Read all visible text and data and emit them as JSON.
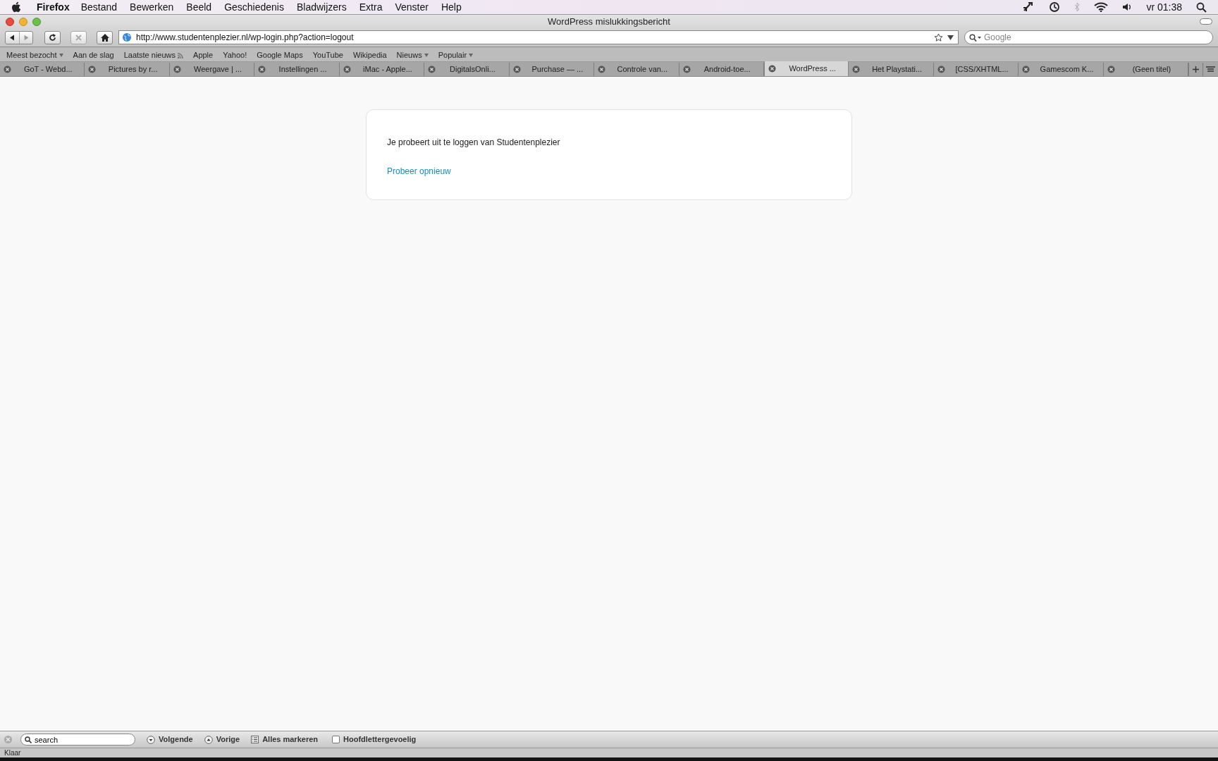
{
  "menu_bar": {
    "app": "Firefox",
    "items": [
      "Bestand",
      "Bewerken",
      "Beeld",
      "Geschiedenis",
      "Bladwijzers",
      "Extra",
      "Venster",
      "Help"
    ],
    "clock": "vr 01:38"
  },
  "window": {
    "title": "WordPress mislukkingsbericht"
  },
  "toolbar": {
    "url": "http://www.studentenplezier.nl/wp-login.php?action=logout",
    "search_placeholder": "Google"
  },
  "bookmarks": [
    {
      "label": "Meest bezocht",
      "kind": "folder"
    },
    {
      "label": "Aan de slag",
      "kind": "link"
    },
    {
      "label": "Laatste nieuws",
      "kind": "feed"
    },
    {
      "label": "Apple",
      "kind": "link"
    },
    {
      "label": "Yahoo!",
      "kind": "link"
    },
    {
      "label": "Google Maps",
      "kind": "link"
    },
    {
      "label": "YouTube",
      "kind": "link"
    },
    {
      "label": "Wikipedia",
      "kind": "link"
    },
    {
      "label": "Nieuws",
      "kind": "folder"
    },
    {
      "label": "Populair",
      "kind": "folder"
    }
  ],
  "tabs": [
    {
      "label": "GoT - Webd...",
      "selected": false
    },
    {
      "label": "Pictures by r...",
      "selected": false
    },
    {
      "label": "Weergave | ...",
      "selected": false
    },
    {
      "label": "Instellingen ...",
      "selected": false
    },
    {
      "label": "iMac - Apple...",
      "selected": false
    },
    {
      "label": "DigitalsOnli...",
      "selected": false
    },
    {
      "label": "Purchase — ...",
      "selected": false
    },
    {
      "label": "Controle van...",
      "selected": false
    },
    {
      "label": "Android-toe...",
      "selected": false
    },
    {
      "label": "WordPress ...",
      "selected": true
    },
    {
      "label": "Het Playstati...",
      "selected": false
    },
    {
      "label": "[CSS/XHTML...",
      "selected": false
    },
    {
      "label": "Gamescom K...",
      "selected": false
    },
    {
      "label": "(Geen titel)",
      "selected": false
    }
  ],
  "page": {
    "message": "Je probeert uit te loggen van Studentenplezier",
    "link": "Probeer opnieuw"
  },
  "find_bar": {
    "value": "search",
    "next": "Volgende",
    "previous": "Vorige",
    "highlight_all": "Alles markeren",
    "match_case": {
      "label": "Hoofdlettergevoelig",
      "checked": false
    }
  },
  "status_bar": "Klaar"
}
